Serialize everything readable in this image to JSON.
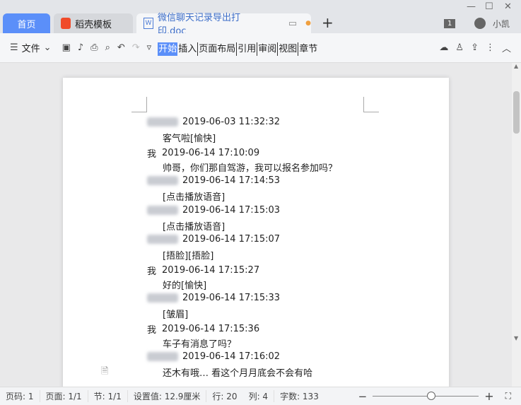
{
  "tabs": [
    {
      "label": "首页"
    },
    {
      "label": "稻壳模板"
    },
    {
      "label": "微信聊天记录导出打印.doc"
    }
  ],
  "user": {
    "badge": "1",
    "name": "小凯"
  },
  "toolbar": {
    "file": "文件",
    "menu": [
      "开始",
      "插入",
      "页面布局",
      "引用",
      "审阅",
      "视图",
      "章节"
    ]
  },
  "messages": [
    {
      "sender": "",
      "time": "2019-06-03 11:32:32",
      "text": "客气啦[愉快]"
    },
    {
      "sender": "我",
      "time": "2019-06-14 17:10:09",
      "text": "帅哥，你们那自驾游，我可以报名参加吗？"
    },
    {
      "sender": "",
      "time": "2019-06-14 17:14:53",
      "text": "[点击播放语音]"
    },
    {
      "sender": "",
      "time": "2019-06-14 17:15:03",
      "text": "[点击播放语音]"
    },
    {
      "sender": "",
      "time": "2019-06-14 17:15:07",
      "text": "[捂脸][捂脸]"
    },
    {
      "sender": "我",
      "time": "2019-06-14 17:15:27",
      "text": "好的[愉快]"
    },
    {
      "sender": "",
      "time": "2019-06-14 17:15:33",
      "text": "[皱眉]"
    },
    {
      "sender": "我",
      "time": "2019-06-14 17:15:36",
      "text": "车子有消息了吗？"
    },
    {
      "sender": "",
      "time": "2019-06-14 17:16:02",
      "text": "还木有哦… 看这个月月底会不会有哈"
    }
  ],
  "status": {
    "page_no": "页码: 1",
    "pages": "页面: 1/1",
    "section": "节: 1/1",
    "setting": "设置值: 12.9厘米",
    "row": "行: 20",
    "col": "列: 4",
    "words": "字数: 133"
  },
  "zoom": {
    "level": 0.55
  }
}
